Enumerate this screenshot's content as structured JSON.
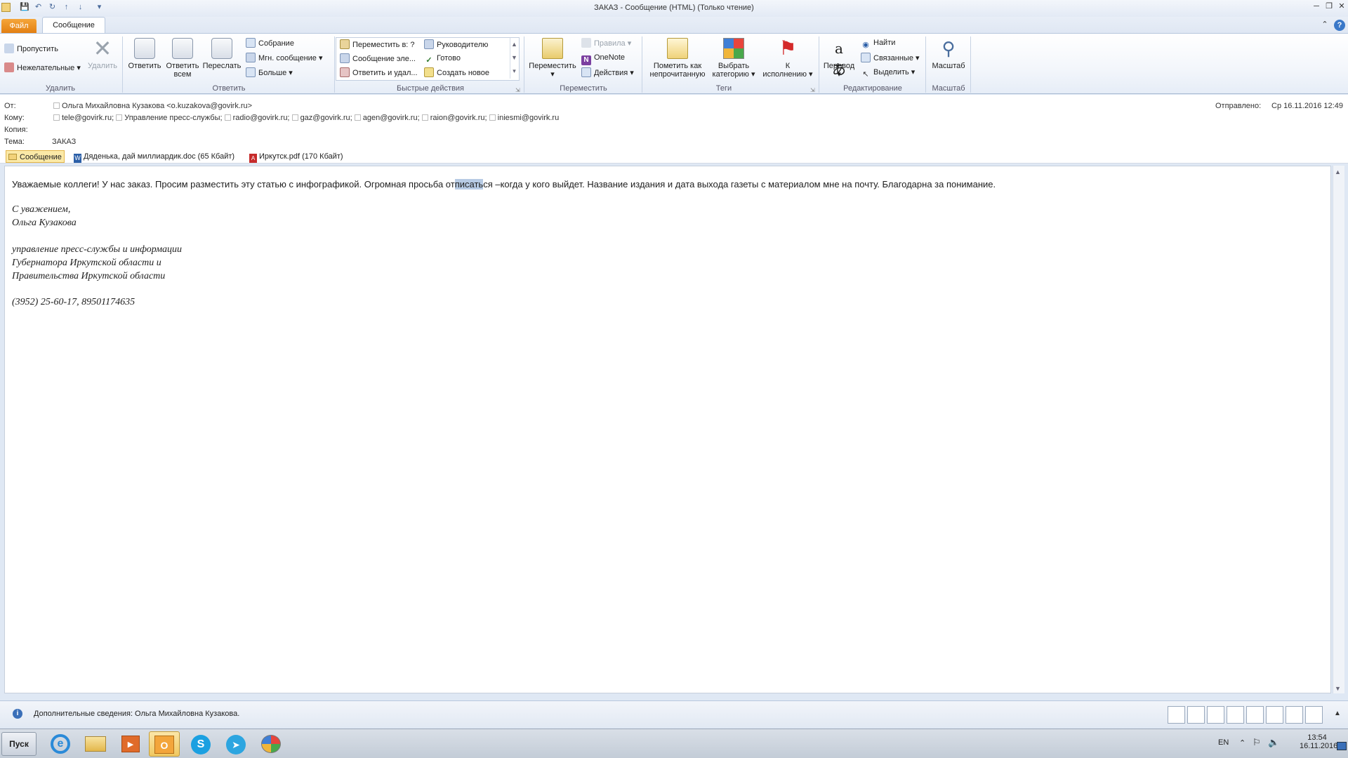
{
  "window": {
    "title": "ЗАКАЗ - Сообщение (HTML) (Только чтение)"
  },
  "tabs": {
    "file": "Файл",
    "message": "Сообщение"
  },
  "ribbon": {
    "delete": {
      "ignore": "Пропустить",
      "junk": "Нежелательные",
      "delete": "Удалить",
      "label": "Удалить"
    },
    "respond": {
      "reply": "Ответить",
      "reply_all_1": "Ответить",
      "reply_all_2": "всем",
      "forward": "Переслать",
      "meeting": "Собрание",
      "im": "Мгн. сообщение",
      "more": "Больше",
      "label": "Ответить"
    },
    "quick": {
      "move_to": "Переместить в: ?",
      "to_manager": "Руководителю",
      "email": "Сообщение эле...",
      "done": "Готово",
      "reply_delete": "Ответить и удал...",
      "create_new": "Создать новое",
      "label": "Быстрые действия"
    },
    "move": {
      "move": "Переместить",
      "rules": "Правила",
      "onenote": "OneNote",
      "actions": "Действия",
      "label": "Переместить"
    },
    "tags": {
      "unread_1": "Пометить как",
      "unread_2": "непрочитанную",
      "cat_1": "Выбрать",
      "cat_2": "категорию",
      "follow_1": "К",
      "follow_2": "исполнению",
      "label": "Теги"
    },
    "editing": {
      "translate": "Перевод",
      "find": "Найти",
      "related": "Связанные",
      "select": "Выделить",
      "label": "Редактирование"
    },
    "zoom": {
      "zoom": "Масштаб",
      "label": "Масштаб"
    }
  },
  "headers": {
    "from_label": "От:",
    "from_value": "Ольга Михайловна Кузакова <o.kuzakova@govirk.ru>",
    "to_label": "Кому:",
    "to": [
      "tele@govirk.ru;",
      "Управление пресс-службы;",
      "radio@govirk.ru;",
      "gaz@govirk.ru;",
      "agen@govirk.ru;",
      "raion@govirk.ru;",
      "iniesmi@govirk.ru"
    ],
    "cc_label": "Копия:",
    "subject_label": "Тема:",
    "subject_value": "ЗАКАЗ",
    "sent_label": "Отправлено:",
    "sent_value": "Ср 16.11.2016 12:49"
  },
  "attachments": [
    {
      "label": "Сообщение"
    },
    {
      "label": "Дяденька, дай миллиардик.doc (65 Кбайт)"
    },
    {
      "label": "Иркутск.pdf (170 Кбайт)"
    }
  ],
  "body": {
    "line1_a": "Уважаемые коллеги! У нас заказ. Просим разместить эту статью с инфографикой. Огромная просьба от",
    "line1_sel": "писать",
    "line1_b": "ся –когда у кого выйдет. Название издания и дата выхода газеты с материалом мне на почту. Благодарна за понимание.",
    "sig1": "С уважением,",
    "sig2": "Ольга Кузакова",
    "org1": "управление пресс-службы и информации",
    "org2": "Губернатора Иркутской области и",
    "org3": "Правительства Иркутской области",
    "phone": "(3952) 25-60-17, 89501174635"
  },
  "people_pane": {
    "info": "Дополнительные сведения: Ольга Михайловна Кузакова."
  },
  "taskbar": {
    "start": "Пуск",
    "lang": "EN",
    "time": "13:54",
    "date": "16.11.2016"
  },
  "colors": {
    "accent": "#e37f12",
    "selection": "#b7cbe4"
  }
}
